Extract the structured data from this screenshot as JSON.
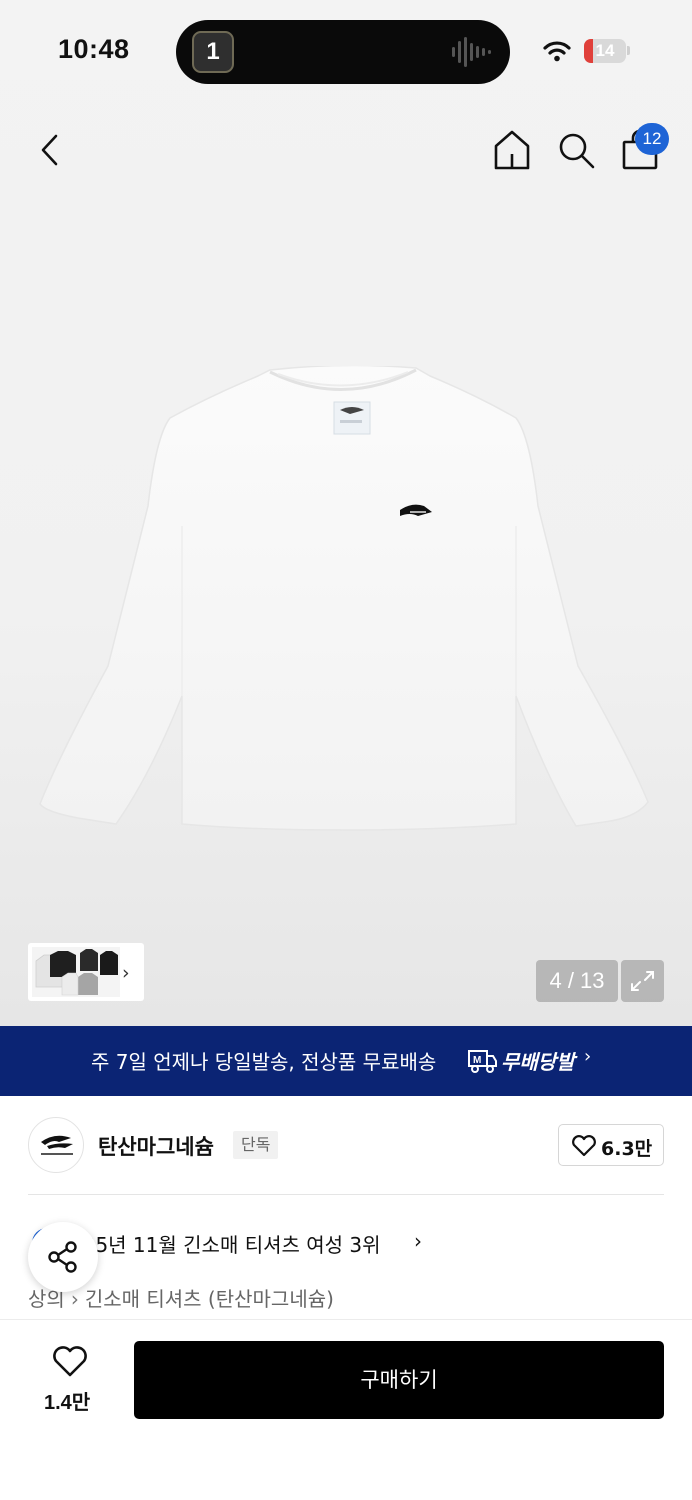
{
  "status_bar": {
    "time": "10:48",
    "island_app_label": "1",
    "battery": "14"
  },
  "nav": {
    "cart_count": "12"
  },
  "gallery": {
    "page_indicator": "4 / 13",
    "thumb_chevron": "›"
  },
  "banner": {
    "text": "주 7일 언제나 당일발송, 전상품 무료배송",
    "brand": "무배당발",
    "chevron": "›",
    "background": "#0b2474"
  },
  "brand": {
    "name": "탄산마그네슘",
    "tag": "단독",
    "likes": "6.3만"
  },
  "ranking": {
    "text": "025년 11월 긴소매 티셔츠 여성 3위",
    "chevron": "›"
  },
  "breadcrumb": {
    "level1": "상의",
    "separator": "›",
    "level2": "긴소매 티셔츠 (탄산마그네슘)"
  },
  "bottom": {
    "like_count": "1.4만",
    "buy_label": "구매하기"
  },
  "colors": {
    "accent": "#1e64d6",
    "battery_low": "#e0403a"
  }
}
